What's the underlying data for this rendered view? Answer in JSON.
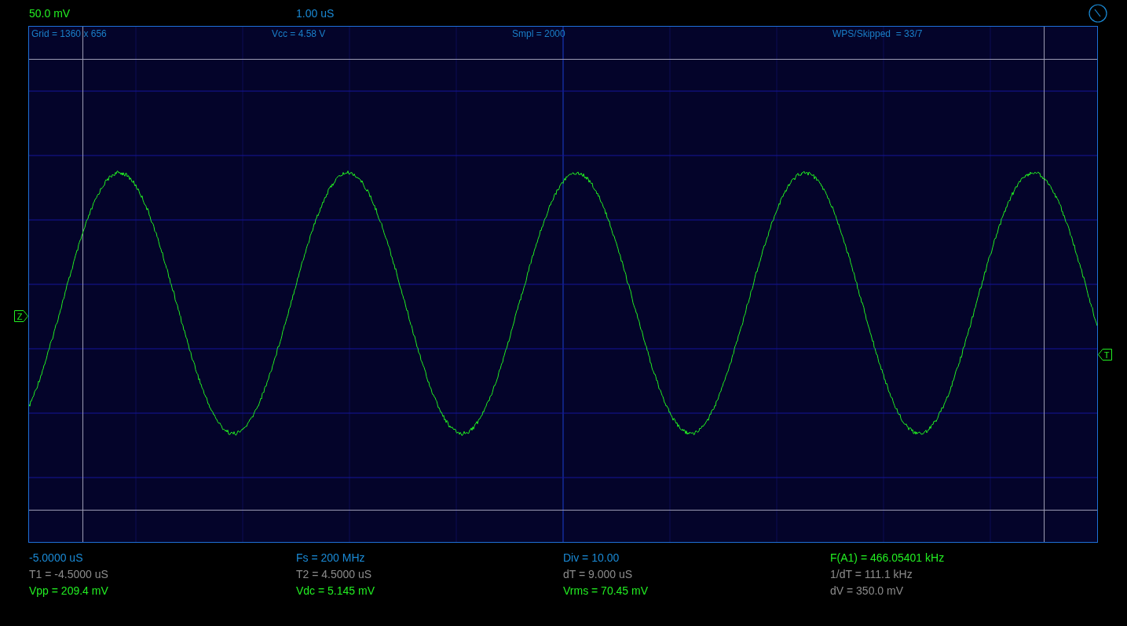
{
  "top_bar": {
    "volts_per_div": "50.0 mV",
    "time_per_div": "1.00 uS"
  },
  "plot": {
    "header": [
      "Grid = 1360 x 656",
      "Vcc = 4.58 V",
      "Smpl = 2000",
      "WPS/Skipped  = 33/7"
    ],
    "channel_marker": "Z",
    "trigger_marker": "T"
  },
  "readouts": [
    {
      "text": "-5.0000 uS",
      "kind": "scale"
    },
    {
      "text": "Fs = 200 MHz",
      "kind": "scale"
    },
    {
      "text": "Div = 10.00",
      "kind": "scale"
    },
    {
      "text": "F(A1) = 466.05401 kHz",
      "kind": "measure"
    },
    {
      "text": "T1 = -4.5000 uS",
      "kind": "cursor"
    },
    {
      "text": "T2 = 4.5000 uS",
      "kind": "cursor"
    },
    {
      "text": "dT = 9.000 uS",
      "kind": "cursor"
    },
    {
      "text": "1/dT = 111.1 kHz",
      "kind": "cursor"
    },
    {
      "text": "Vpp = 209.4 mV",
      "kind": "measure"
    },
    {
      "text": "Vdc = 5.145 mV",
      "kind": "measure"
    },
    {
      "text": "Vrms = 70.45 mV",
      "kind": "measure"
    },
    {
      "text": "dV = 350.0 mV",
      "kind": "cursor"
    }
  ]
}
